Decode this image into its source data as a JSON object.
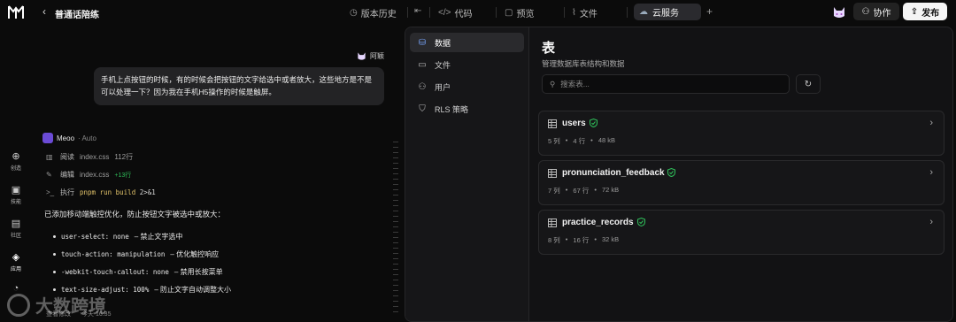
{
  "header": {
    "back_icon": "chevron-left-icon",
    "title": "普通话陪练",
    "version_history": "版本历史",
    "code": "代码",
    "preview": "预览",
    "files": "文件",
    "cloud_service": "云服务",
    "collaborate": "协作",
    "publish": "发布"
  },
  "rail": {
    "items": [
      {
        "label": "创造",
        "icon": "plus-circle-icon"
      },
      {
        "label": "技能",
        "icon": "bag-icon"
      },
      {
        "label": "社区",
        "icon": "community-icon"
      },
      {
        "label": "应用",
        "icon": "cube-icon"
      }
    ]
  },
  "chat": {
    "user_name": "阿颖",
    "user_message": "手机上点按钮的时候，有的时候会把按钮的文字给选中或者放大，这些地方是不是可以处理一下？因为我在手机H5操作的时候是触屏。",
    "assistant_name": "Meoo",
    "assistant_mode": "· Auto",
    "actions": [
      {
        "label": "阅读",
        "file": "index.css",
        "meta": "112行"
      },
      {
        "label": "编辑",
        "file": "index.css",
        "meta": "+13行"
      },
      {
        "label": "执行",
        "cmd_main": "pnpm run build",
        "cmd_rest": "2>&1"
      }
    ],
    "summary": "已添加移动端触控优化，防止按钮文字被选中或放大：",
    "bullets": [
      {
        "code": "user-select: none",
        "desc": "– 禁止文字选中"
      },
      {
        "code": "touch-action: manipulation",
        "desc": "– 优化触控响应"
      },
      {
        "code": "-webkit-touch-callout: none",
        "desc": "– 禁用长按菜单"
      },
      {
        "code": "text-size-adjust: 100%",
        "desc": "– 防止文字自动调整大小"
      }
    ],
    "footer_left": "查看修改",
    "footer_right": "今天 16:35",
    "watermark": "大数跨境"
  },
  "panel": {
    "nav": [
      {
        "label": "数据",
        "icon": "database-icon",
        "active": true
      },
      {
        "label": "文件",
        "icon": "folder-icon",
        "active": false
      },
      {
        "label": "用户",
        "icon": "user-icon",
        "active": false
      },
      {
        "label": "RLS 策略",
        "icon": "shield-icon",
        "active": false
      }
    ],
    "title": "表",
    "subtitle": "管理数据库表结构和数据",
    "search_placeholder": "搜索表...",
    "tables": [
      {
        "name": "users",
        "cols": "5 列",
        "rows": "4 行",
        "size": "48 kB"
      },
      {
        "name": "pronunciation_feedback",
        "cols": "7 列",
        "rows": "67 行",
        "size": "72 kB"
      },
      {
        "name": "practice_records",
        "cols": "8 列",
        "rows": "16 行",
        "size": "32 kB"
      }
    ],
    "accent": "#2fbf5a"
  }
}
